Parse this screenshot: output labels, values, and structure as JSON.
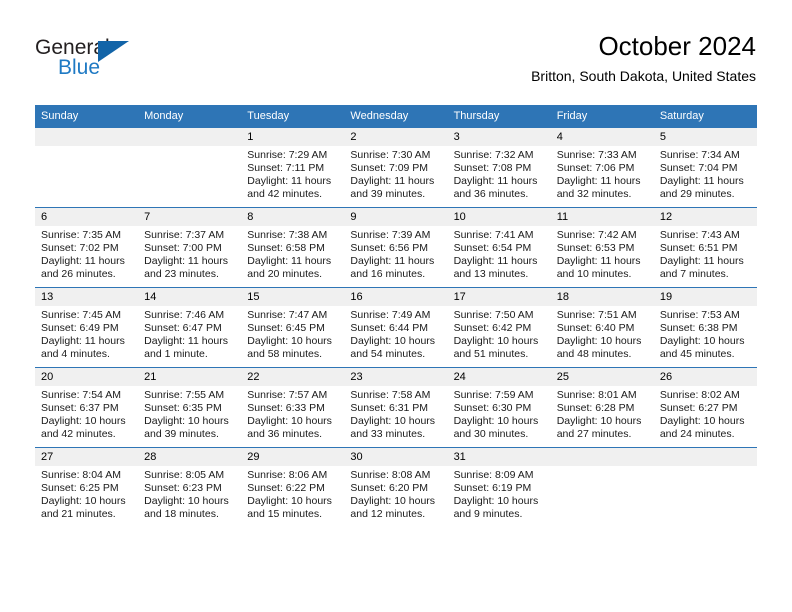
{
  "brand": {
    "name_part1": "General",
    "name_part2": "Blue",
    "accent_color": "#1264a8",
    "text_color": "#231f20"
  },
  "header": {
    "title": "October 2024",
    "location": "Britton, South Dakota, United States"
  },
  "theme": {
    "header_blue": "#2e75b6",
    "daynum_band": "#f0f0f0"
  },
  "weekdays": [
    "Sunday",
    "Monday",
    "Tuesday",
    "Wednesday",
    "Thursday",
    "Friday",
    "Saturday"
  ],
  "labels": {
    "sunrise": "Sunrise:",
    "sunset": "Sunset:",
    "daylight": "Daylight:"
  },
  "weeks": [
    [
      {
        "day": "",
        "blank": true
      },
      {
        "day": "",
        "blank": true
      },
      {
        "day": "1",
        "sunrise": "Sunrise: 7:29 AM",
        "sunset": "Sunset: 7:11 PM",
        "daylight": "Daylight: 11 hours and 42 minutes."
      },
      {
        "day": "2",
        "sunrise": "Sunrise: 7:30 AM",
        "sunset": "Sunset: 7:09 PM",
        "daylight": "Daylight: 11 hours and 39 minutes."
      },
      {
        "day": "3",
        "sunrise": "Sunrise: 7:32 AM",
        "sunset": "Sunset: 7:08 PM",
        "daylight": "Daylight: 11 hours and 36 minutes."
      },
      {
        "day": "4",
        "sunrise": "Sunrise: 7:33 AM",
        "sunset": "Sunset: 7:06 PM",
        "daylight": "Daylight: 11 hours and 32 minutes."
      },
      {
        "day": "5",
        "sunrise": "Sunrise: 7:34 AM",
        "sunset": "Sunset: 7:04 PM",
        "daylight": "Daylight: 11 hours and 29 minutes."
      }
    ],
    [
      {
        "day": "6",
        "sunrise": "Sunrise: 7:35 AM",
        "sunset": "Sunset: 7:02 PM",
        "daylight": "Daylight: 11 hours and 26 minutes."
      },
      {
        "day": "7",
        "sunrise": "Sunrise: 7:37 AM",
        "sunset": "Sunset: 7:00 PM",
        "daylight": "Daylight: 11 hours and 23 minutes."
      },
      {
        "day": "8",
        "sunrise": "Sunrise: 7:38 AM",
        "sunset": "Sunset: 6:58 PM",
        "daylight": "Daylight: 11 hours and 20 minutes."
      },
      {
        "day": "9",
        "sunrise": "Sunrise: 7:39 AM",
        "sunset": "Sunset: 6:56 PM",
        "daylight": "Daylight: 11 hours and 16 minutes."
      },
      {
        "day": "10",
        "sunrise": "Sunrise: 7:41 AM",
        "sunset": "Sunset: 6:54 PM",
        "daylight": "Daylight: 11 hours and 13 minutes."
      },
      {
        "day": "11",
        "sunrise": "Sunrise: 7:42 AM",
        "sunset": "Sunset: 6:53 PM",
        "daylight": "Daylight: 11 hours and 10 minutes."
      },
      {
        "day": "12",
        "sunrise": "Sunrise: 7:43 AM",
        "sunset": "Sunset: 6:51 PM",
        "daylight": "Daylight: 11 hours and 7 minutes."
      }
    ],
    [
      {
        "day": "13",
        "sunrise": "Sunrise: 7:45 AM",
        "sunset": "Sunset: 6:49 PM",
        "daylight": "Daylight: 11 hours and 4 minutes."
      },
      {
        "day": "14",
        "sunrise": "Sunrise: 7:46 AM",
        "sunset": "Sunset: 6:47 PM",
        "daylight": "Daylight: 11 hours and 1 minute."
      },
      {
        "day": "15",
        "sunrise": "Sunrise: 7:47 AM",
        "sunset": "Sunset: 6:45 PM",
        "daylight": "Daylight: 10 hours and 58 minutes."
      },
      {
        "day": "16",
        "sunrise": "Sunrise: 7:49 AM",
        "sunset": "Sunset: 6:44 PM",
        "daylight": "Daylight: 10 hours and 54 minutes."
      },
      {
        "day": "17",
        "sunrise": "Sunrise: 7:50 AM",
        "sunset": "Sunset: 6:42 PM",
        "daylight": "Daylight: 10 hours and 51 minutes."
      },
      {
        "day": "18",
        "sunrise": "Sunrise: 7:51 AM",
        "sunset": "Sunset: 6:40 PM",
        "daylight": "Daylight: 10 hours and 48 minutes."
      },
      {
        "day": "19",
        "sunrise": "Sunrise: 7:53 AM",
        "sunset": "Sunset: 6:38 PM",
        "daylight": "Daylight: 10 hours and 45 minutes."
      }
    ],
    [
      {
        "day": "20",
        "sunrise": "Sunrise: 7:54 AM",
        "sunset": "Sunset: 6:37 PM",
        "daylight": "Daylight: 10 hours and 42 minutes."
      },
      {
        "day": "21",
        "sunrise": "Sunrise: 7:55 AM",
        "sunset": "Sunset: 6:35 PM",
        "daylight": "Daylight: 10 hours and 39 minutes."
      },
      {
        "day": "22",
        "sunrise": "Sunrise: 7:57 AM",
        "sunset": "Sunset: 6:33 PM",
        "daylight": "Daylight: 10 hours and 36 minutes."
      },
      {
        "day": "23",
        "sunrise": "Sunrise: 7:58 AM",
        "sunset": "Sunset: 6:31 PM",
        "daylight": "Daylight: 10 hours and 33 minutes."
      },
      {
        "day": "24",
        "sunrise": "Sunrise: 7:59 AM",
        "sunset": "Sunset: 6:30 PM",
        "daylight": "Daylight: 10 hours and 30 minutes."
      },
      {
        "day": "25",
        "sunrise": "Sunrise: 8:01 AM",
        "sunset": "Sunset: 6:28 PM",
        "daylight": "Daylight: 10 hours and 27 minutes."
      },
      {
        "day": "26",
        "sunrise": "Sunrise: 8:02 AM",
        "sunset": "Sunset: 6:27 PM",
        "daylight": "Daylight: 10 hours and 24 minutes."
      }
    ],
    [
      {
        "day": "27",
        "sunrise": "Sunrise: 8:04 AM",
        "sunset": "Sunset: 6:25 PM",
        "daylight": "Daylight: 10 hours and 21 minutes."
      },
      {
        "day": "28",
        "sunrise": "Sunrise: 8:05 AM",
        "sunset": "Sunset: 6:23 PM",
        "daylight": "Daylight: 10 hours and 18 minutes."
      },
      {
        "day": "29",
        "sunrise": "Sunrise: 8:06 AM",
        "sunset": "Sunset: 6:22 PM",
        "daylight": "Daylight: 10 hours and 15 minutes."
      },
      {
        "day": "30",
        "sunrise": "Sunrise: 8:08 AM",
        "sunset": "Sunset: 6:20 PM",
        "daylight": "Daylight: 10 hours and 12 minutes."
      },
      {
        "day": "31",
        "sunrise": "Sunrise: 8:09 AM",
        "sunset": "Sunset: 6:19 PM",
        "daylight": "Daylight: 10 hours and 9 minutes."
      },
      {
        "day": "",
        "blank": true
      },
      {
        "day": "",
        "blank": true
      }
    ]
  ]
}
